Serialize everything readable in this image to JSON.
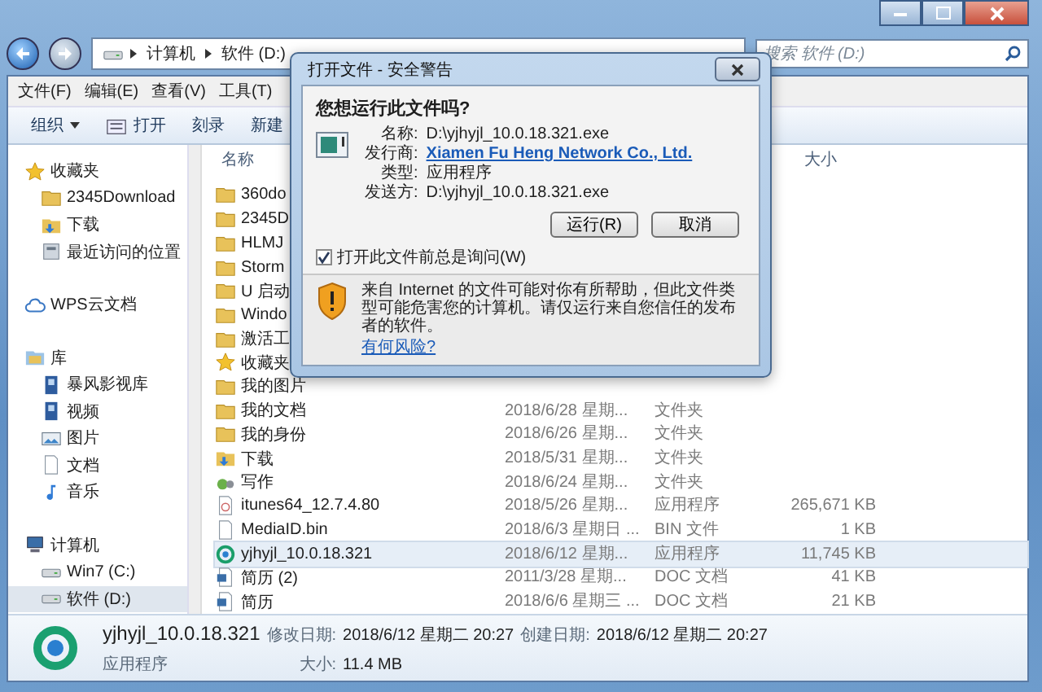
{
  "address_bar": {
    "breadcrumbs": [
      "计算机",
      "软件 (D:)"
    ],
    "search": {
      "placeholder": "搜索 软件 (D:)"
    }
  },
  "menu": [
    "文件(F)",
    "编辑(E)",
    "查看(V)",
    "工具(T)"
  ],
  "toolbar": [
    {
      "label": "组织",
      "kind": "dropdown"
    },
    {
      "label": "打开",
      "kind": "open"
    },
    {
      "label": "刻录",
      "kind": "plain"
    },
    {
      "label": "新建",
      "kind": "plain"
    }
  ],
  "sidebar": [
    {
      "label": "收藏夹",
      "kind": "star",
      "selected": false,
      "children": [
        {
          "label": "2345Download",
          "kind": "folder",
          "selected": false
        },
        {
          "label": "下载",
          "kind": "download",
          "selected": false
        },
        {
          "label": "最近访问的位置",
          "kind": "recent",
          "selected": false
        }
      ]
    },
    {
      "label": "WPS云文档",
      "kind": "cloud",
      "selected": false
    },
    {
      "label": "库",
      "kind": "library",
      "selected": false,
      "children": [
        {
          "label": "暴风影视库",
          "kind": "video",
          "selected": false
        },
        {
          "label": "视频",
          "kind": "video",
          "selected": false
        },
        {
          "label": "图片",
          "kind": "picture",
          "selected": false
        },
        {
          "label": "文档",
          "kind": "document",
          "selected": false
        },
        {
          "label": "音乐",
          "kind": "music",
          "selected": false
        }
      ]
    },
    {
      "label": "计算机",
      "kind": "computer",
      "selected": false,
      "children": [
        {
          "label": "Win7 (C:)",
          "kind": "drive",
          "selected": false
        },
        {
          "label": "软件 (D:)",
          "kind": "drive",
          "selected": true
        }
      ]
    }
  ],
  "file_list": {
    "header": {
      "name": "名称",
      "size": "大小"
    },
    "rows": [
      {
        "name": "360do",
        "kind": "folder",
        "selected": false
      },
      {
        "name": "2345D",
        "kind": "folder",
        "selected": false
      },
      {
        "name": "HLMJ",
        "kind": "folder",
        "selected": false
      },
      {
        "name": "Storm",
        "kind": "folder",
        "selected": false
      },
      {
        "name": "U 启动",
        "kind": "folder",
        "selected": false
      },
      {
        "name": "Windo",
        "kind": "folder",
        "selected": false
      },
      {
        "name": "激活工",
        "kind": "folder",
        "selected": false
      },
      {
        "name": "收藏夹",
        "kind": "star",
        "selected": false
      },
      {
        "name": "我的图片",
        "kind": "folder",
        "selected": false
      },
      {
        "name": "我的文档",
        "kind": "folder",
        "selected": false,
        "date": "2018/6/28 星期...",
        "type": "文件夹"
      },
      {
        "name": "我的身份",
        "kind": "folder",
        "selected": false,
        "date": "2018/6/26 星期...",
        "type": "文件夹"
      },
      {
        "name": "下载",
        "kind": "download",
        "selected": false,
        "date": "2018/5/31 星期...",
        "type": "文件夹"
      },
      {
        "name": "写作",
        "kind": "writing",
        "selected": false,
        "date": "2018/6/24 星期...",
        "type": "文件夹"
      },
      {
        "name": "itunes64_12.7.4.80",
        "kind": "installer",
        "selected": false,
        "date": "2018/5/26 星期...",
        "type": "应用程序",
        "size": "265,671 KB"
      },
      {
        "name": "MediaID.bin",
        "kind": "file",
        "selected": false,
        "date": "2018/6/3 星期日 ...",
        "type": "BIN 文件",
        "size": "1 KB"
      },
      {
        "name": "yjhyjl_10.0.18.321",
        "kind": "app",
        "selected": true,
        "date": "2018/6/12 星期...",
        "type": "应用程序",
        "size": "11,745 KB"
      },
      {
        "name": "简历 (2)",
        "kind": "doc",
        "selected": false,
        "date": "2011/3/28 星期...",
        "type": "DOC 文档",
        "size": "41 KB"
      },
      {
        "name": "简历",
        "kind": "doc",
        "selected": false,
        "date": "2018/6/6 星期三 ...",
        "type": "DOC 文档",
        "size": "21 KB"
      }
    ]
  },
  "details": {
    "name": "yjhyjl_10.0.18.321",
    "modified_label": "修改日期:",
    "modified": "2018/6/12 星期二 20:27",
    "created_label": "创建日期:",
    "created": "2018/6/12 星期二 20:27",
    "type": "应用程序",
    "size_label": "大小:",
    "size": "11.4 MB"
  },
  "dialog": {
    "title": "打开文件 - 安全警告",
    "heading": "您想运行此文件吗?",
    "fields": [
      {
        "label": "名称:",
        "value": "D:\\yjhyjl_10.0.18.321.exe",
        "kind": "text"
      },
      {
        "label": "发行商:",
        "value": "Xiamen Fu Heng Network Co., Ltd.",
        "kind": "link"
      },
      {
        "label": "类型:",
        "value": "应用程序",
        "kind": "text"
      },
      {
        "label": "发送方:",
        "value": "D:\\yjhyjl_10.0.18.321.exe",
        "kind": "text"
      }
    ],
    "buttons": [
      "运行(R)",
      "取消"
    ],
    "always_ask": {
      "label": "打开此文件前总是询问(W)",
      "checked": true
    },
    "warning": {
      "text": "来自 Internet 的文件可能对你有所帮助，但此文件类型可能危害您的计算机。请仅运行来自您信任的发布者的软件。",
      "link": "有何风险?"
    }
  }
}
